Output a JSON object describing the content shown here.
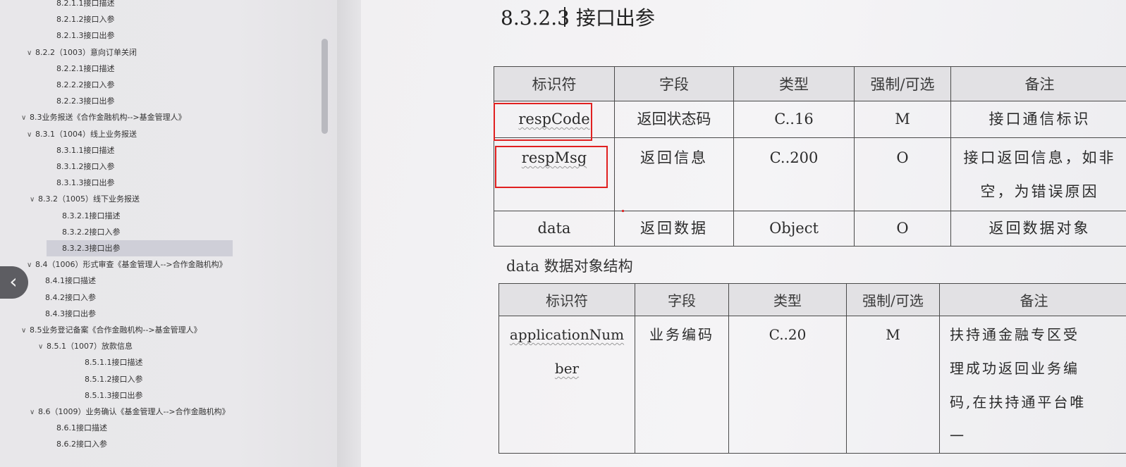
{
  "sidebar": {
    "items": [
      {
        "label": "8.2.1.1接口描述",
        "level": 4,
        "expanded": null,
        "selected": false
      },
      {
        "label": "8.2.1.2接口入参",
        "level": 4,
        "expanded": null,
        "selected": false
      },
      {
        "label": "8.2.1.3接口出参",
        "level": 4,
        "expanded": null,
        "selected": false
      },
      {
        "label": "8.2.2（1003）意向订单关闭",
        "level": 3,
        "expanded": true,
        "selected": false
      },
      {
        "label": "8.2.2.1接口描述",
        "level": 4,
        "expanded": null,
        "selected": false
      },
      {
        "label": "8.2.2.2接口入参",
        "level": 4,
        "expanded": null,
        "selected": false
      },
      {
        "label": "8.2.2.3接口出参",
        "level": 4,
        "expanded": null,
        "selected": false
      },
      {
        "label": "8.3业务报送《合作金融机构-->基金管理人》",
        "level": 2,
        "expanded": true,
        "selected": false
      },
      {
        "label": "8.3.1（1004）线上业务报送",
        "level": 3,
        "expanded": true,
        "selected": false
      },
      {
        "label": "8.3.1.1接口描述",
        "level": 4,
        "expanded": null,
        "selected": false
      },
      {
        "label": "8.3.1.2接口入参",
        "level": 4,
        "expanded": null,
        "selected": false
      },
      {
        "label": "8.3.1.3接口出参",
        "level": 4,
        "expanded": null,
        "selected": false
      },
      {
        "label": "8.3.2（1005）线下业务报送",
        "level": 3,
        "expanded": true,
        "selected": false
      },
      {
        "label": "8.3.2.1接口描述",
        "level": 4,
        "expanded": null,
        "selected": false
      },
      {
        "label": "8.3.2.2接口入参",
        "level": 4,
        "expanded": null,
        "selected": false
      },
      {
        "label": "8.3.2.3接口出参",
        "level": 4,
        "expanded": null,
        "selected": true
      },
      {
        "label": "8.4（1006）形式审查《基金管理人-->合作金融机构》",
        "level": 2,
        "expanded": true,
        "selected": false
      },
      {
        "label": "8.4.1接口描述",
        "level": 3,
        "expanded": null,
        "selected": false
      },
      {
        "label": "8.4.2接口入参",
        "level": 3,
        "expanded": null,
        "selected": false
      },
      {
        "label": "8.4.3接口出参",
        "level": 3,
        "expanded": null,
        "selected": false
      },
      {
        "label": "8.5业务登记备案《合作金融机构-->基金管理人》",
        "level": 2,
        "expanded": true,
        "selected": false
      },
      {
        "label": "8.5.1（1007）放款信息",
        "level": 3,
        "expanded": true,
        "selected": false
      },
      {
        "label": "8.5.1.1接口描述",
        "level": 4,
        "expanded": null,
        "selected": false
      },
      {
        "label": "8.5.1.2接口入参",
        "level": 4,
        "expanded": null,
        "selected": false
      },
      {
        "label": "8.5.1.3接口出参",
        "level": 4,
        "expanded": null,
        "selected": false
      },
      {
        "label": "8.6（1009）业务确认《基金管理人-->合作金融机构》",
        "level": 2,
        "expanded": true,
        "selected": false
      },
      {
        "label": "8.6.1接口描述",
        "level": 3,
        "expanded": null,
        "selected": false
      },
      {
        "label": "8.6.2接口入参",
        "level": 3,
        "expanded": null,
        "selected": false
      }
    ]
  },
  "back_button": {
    "glyph": "‹"
  },
  "doc": {
    "heading": "8.3.2.3 接口出参",
    "table1": {
      "headers": [
        "标识符",
        "字段",
        "类型",
        "强制/可选",
        "备注"
      ],
      "rows": [
        [
          "respCode",
          "返回状态码",
          "C..16",
          "M",
          "接口通信标识"
        ],
        [
          "respMsg",
          "返回信息",
          "C..200",
          "O",
          "接口返回信息，如非\n空，为错误原因"
        ],
        [
          "data",
          "返回数据",
          "Object",
          "O",
          "返回数据对象"
        ]
      ]
    },
    "caption": "data 数据对象结构",
    "table2": {
      "headers": [
        "标识符",
        "字段",
        "类型",
        "强制/可选",
        "备注"
      ],
      "rows": [
        [
          "applicationNum\nber",
          "业务编码",
          "C..20",
          "M",
          "扶持通金融专区受\n理成功返回业务编\n码,在扶持通平台唯\n一"
        ]
      ]
    }
  }
}
